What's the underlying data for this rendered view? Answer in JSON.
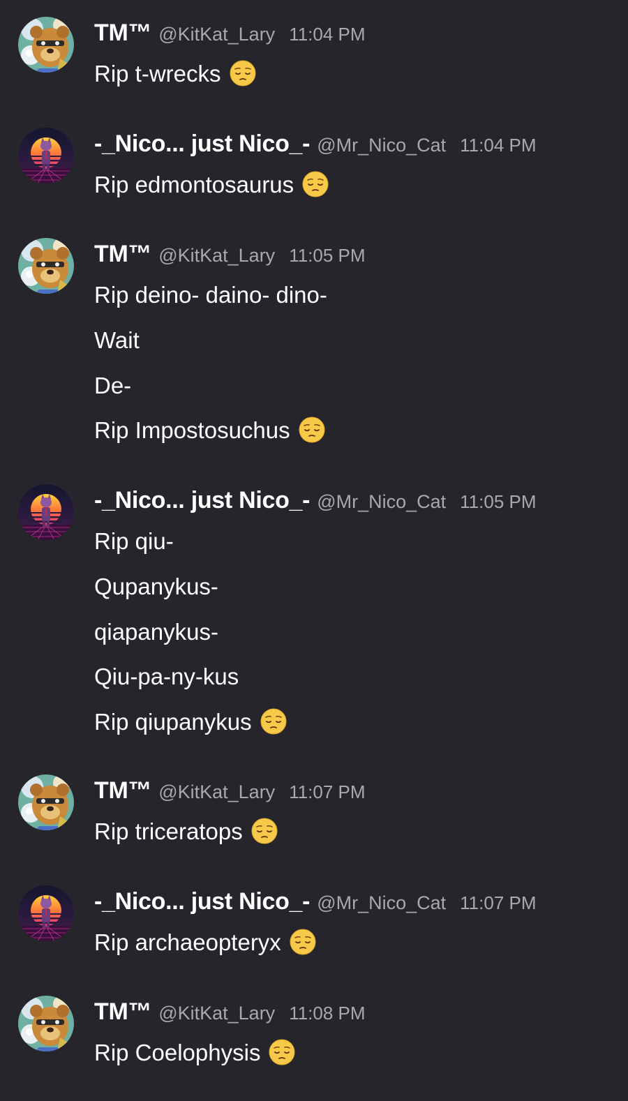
{
  "users": {
    "tm": {
      "display_name": "TM™",
      "handle": "@KitKat_Lary",
      "avatar_icon": "animatronic-bear-avatar-icon"
    },
    "nico": {
      "display_name": "-_Nico... just Nico_-",
      "handle": "@Mr_Nico_Cat",
      "avatar_icon": "retro-sunset-cat-avatar-icon"
    }
  },
  "messages": [
    {
      "user": "tm",
      "time": "11:04 PM",
      "lines": [
        {
          "text": "Rip t-wrecks",
          "emoji": true
        }
      ]
    },
    {
      "user": "nico",
      "time": "11:04 PM",
      "lines": [
        {
          "text": "Rip edmontosaurus",
          "emoji": true
        }
      ]
    },
    {
      "user": "tm",
      "time": "11:05 PM",
      "lines": [
        {
          "text": "Rip deino- daino- dino-",
          "emoji": false
        },
        {
          "text": "Wait",
          "emoji": false
        },
        {
          "text": "De-",
          "emoji": false
        },
        {
          "text": "Rip Impostosuchus",
          "emoji": true
        }
      ]
    },
    {
      "user": "nico",
      "time": "11:05 PM",
      "lines": [
        {
          "text": "Rip qiu-",
          "emoji": false
        },
        {
          "text": "Qupanykus-",
          "emoji": false
        },
        {
          "text": "qiapanykus-",
          "emoji": false
        },
        {
          "text": "Qiu-pa-ny-kus",
          "emoji": false
        },
        {
          "text": "Rip qiupanykus",
          "emoji": true
        }
      ]
    },
    {
      "user": "tm",
      "time": "11:07 PM",
      "lines": [
        {
          "text": "Rip triceratops",
          "emoji": true
        }
      ]
    },
    {
      "user": "nico",
      "time": "11:07 PM",
      "lines": [
        {
          "text": "Rip archaeopteryx",
          "emoji": true
        }
      ]
    },
    {
      "user": "tm",
      "time": "11:08 PM",
      "lines": [
        {
          "text": "Rip Coelophysis",
          "emoji": true
        }
      ]
    }
  ],
  "emoji_icon": "pensive-face-emoji-icon",
  "colors": {
    "background": "#26252c",
    "text": "#ffffff",
    "muted": "#a9a8b0",
    "emoji_yellow": "#f7c948"
  }
}
